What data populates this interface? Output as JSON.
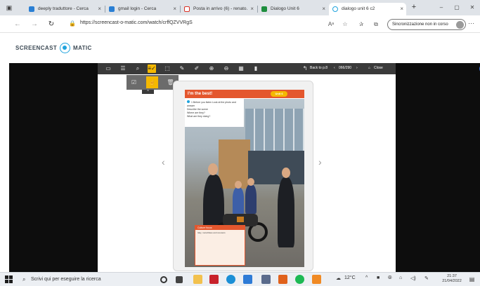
{
  "browser": {
    "tabs": [
      {
        "title": "deeply traduttore - Cerca",
        "icon": "bing-icon",
        "active": false
      },
      {
        "title": "gmail login - Cerca",
        "icon": "bing-icon",
        "active": false
      },
      {
        "title": "Posta in arrivo (6) - renato.",
        "icon": "gmail-icon",
        "active": false
      },
      {
        "title": "Dialogo Unit 6",
        "icon": "classroom-icon",
        "active": false
      },
      {
        "title": "dialogo unit 6 c2",
        "icon": "screencast-icon",
        "active": true
      }
    ],
    "tab_close": "×",
    "new_tab": "+",
    "url": "https://screencast-o-matic.com/watch/crffQZVVRgS",
    "sync_label": "Sincronizzazione non in corso",
    "read_aloud": "Aᵃ"
  },
  "brand": {
    "part1": "SCREENCAST",
    "part2": "MATIC"
  },
  "viewer": {
    "back_label": "Back to p.8",
    "page_counter": "066/290",
    "close_label": "Close",
    "prev_arrow": "‹",
    "next_arrow": "›",
    "book": {
      "title": "I'm the best!",
      "badge": "Unit 6",
      "instruction": "1 Before you listen  Look at the photo and answer",
      "q1": "Describe the scene",
      "q2": "Where are they?",
      "q3": "What are they doing?",
      "box_head": "Culture focus",
      "box_text": "Italy, motorbikes and scooters"
    }
  },
  "taskbar": {
    "search_placeholder": "Scrivi qui per eseguire la ricerca",
    "weather": "12°C",
    "time": "21:37",
    "date": "21/04/2022"
  },
  "colors": {
    "accent_yellow": "#f5b800",
    "brand_blue": "#1fa3dd",
    "book_red": "#e4572e"
  }
}
